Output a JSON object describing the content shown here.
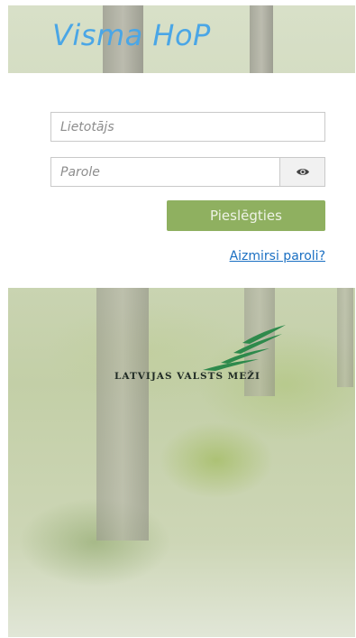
{
  "app": {
    "title": "Visma HoP"
  },
  "login": {
    "username_placeholder": "Lietotājs",
    "password_placeholder": "Parole",
    "submit_label": "Pieslēgties",
    "forgot_label": "Aizmirsi paroli?"
  },
  "logo": {
    "text": "LATVIJAS VALSTS MEŽI"
  },
  "colors": {
    "title": "#4aa6e6",
    "button": "#8fb060",
    "link": "#1a6fc2",
    "logo_green": "#2e8a4c"
  },
  "icons": {
    "password_toggle": "eye-icon"
  }
}
